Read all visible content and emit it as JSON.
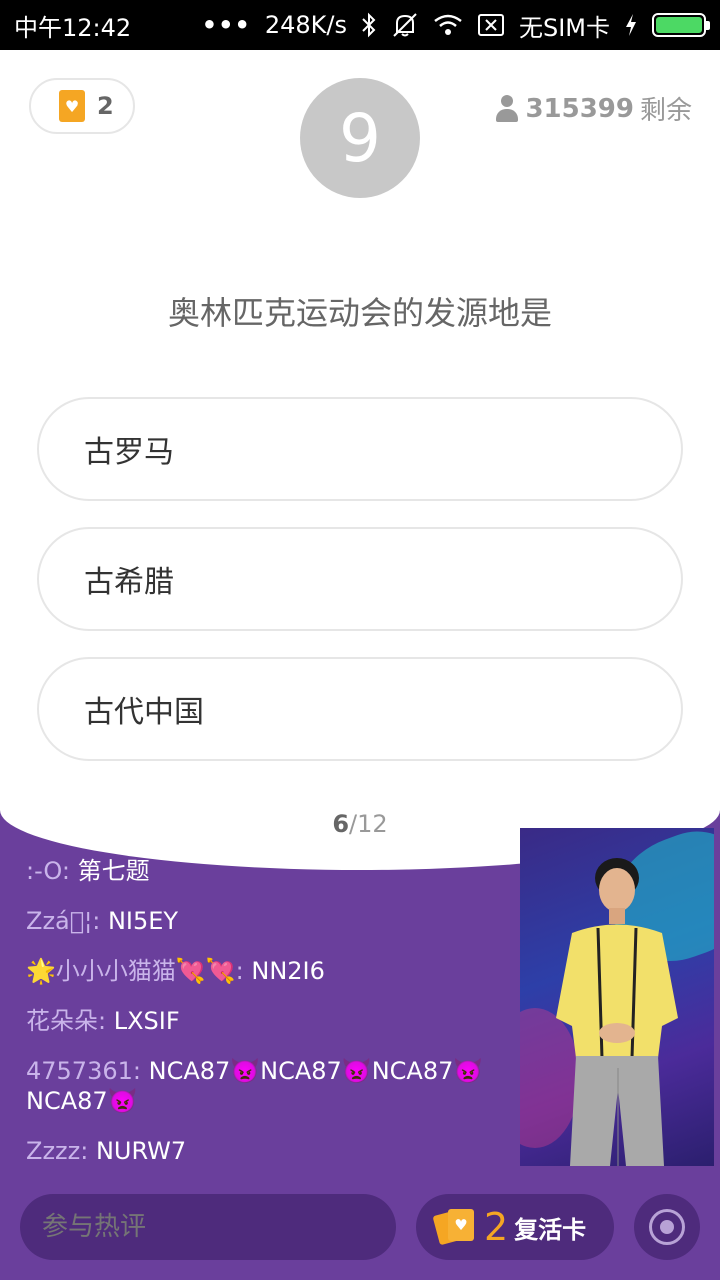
{
  "status_bar": {
    "time": "中午12:42",
    "dots": "•••",
    "network_speed": "248K/s",
    "sim": "无SIM卡",
    "icons": [
      "bluetooth-icon",
      "mute-icon",
      "wifi-icon",
      "no-sim-icon",
      "charging-icon",
      "battery-icon"
    ],
    "battery_level": 1.0
  },
  "header": {
    "lives_count": "2",
    "timer": "9",
    "remaining_count": "315399",
    "remaining_label": "剩余"
  },
  "question": {
    "text": "奥林匹克运动会的发源地是",
    "options": [
      "古罗马",
      "古希腊",
      "古代中国"
    ],
    "progress_current": "6",
    "progress_total": "/12"
  },
  "chat": {
    "messages": [
      {
        "user": ":-O",
        "text": "第七题"
      },
      {
        "user": "Zzá\u0000¦",
        "text": "NI5EY"
      },
      {
        "user_prefix": "🌟",
        "user": "小小小猫猫",
        "user_suffix": "💘💘",
        "text": "NN2I6"
      },
      {
        "user": "花朵朵",
        "text": "LXSIF"
      },
      {
        "user": "4757361",
        "text": "NCA87👿NCA87👿NCA87👿NCA87👿"
      },
      {
        "user": "Zzzz",
        "text": "NURW7"
      }
    ]
  },
  "bottom": {
    "comment_placeholder": "参与热评",
    "revive_count": "2",
    "revive_label": "复活卡"
  },
  "colors": {
    "background": "#6a3f9c",
    "accent": "#f5a623",
    "bar_bg": "#4e2b7c"
  }
}
